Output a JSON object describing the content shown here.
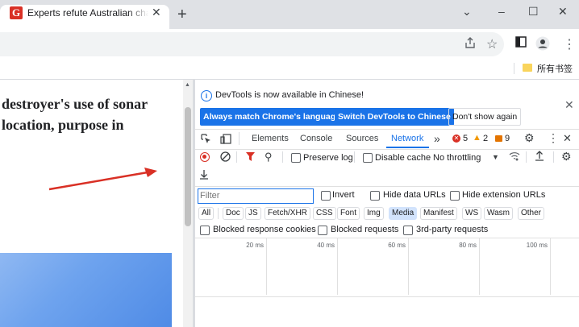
{
  "browser": {
    "tab": {
      "title": "Experts refute Australian cha",
      "favicon_letter": "G"
    },
    "new_tab_symbol": "+",
    "window_controls": {
      "dropdown": "⌄",
      "minimize": "–",
      "maximize": "☐",
      "close": "✕"
    },
    "bookmarks_bar": {
      "folder_label": "所有书签"
    }
  },
  "page": {
    "headline_line1": "destroyer's use of sonar",
    "headline_line2": "location, purpose in"
  },
  "devtools": {
    "infobar": {
      "message": "DevTools is now available in Chinese!",
      "btn_match": "Always match Chrome's language",
      "btn_switch": "Switch DevTools to Chinese",
      "btn_dont_show": "Don't show again"
    },
    "tabs": [
      "Elements",
      "Console",
      "Sources",
      "Network"
    ],
    "more_tabs": "»",
    "active_tab": "Network",
    "counts": {
      "errors": "5",
      "warnings": "2",
      "info": "9"
    },
    "network": {
      "preserve_log": "Preserve log",
      "disable_cache": "Disable cache",
      "throttling": "No throttling",
      "filter_placeholder": "Filter",
      "invert": "Invert",
      "hide_data_urls": "Hide data URLs",
      "hide_extension_urls": "Hide extension URLs",
      "type_filters": [
        "All",
        "Doc",
        "JS",
        "Fetch/XHR",
        "CSS",
        "Font",
        "Img",
        "Media",
        "Manifest",
        "WS",
        "Wasm",
        "Other"
      ],
      "active_type_filter": "Media",
      "blocked_response_cookies": "Blocked response cookies",
      "blocked_requests": "Blocked requests",
      "third_party_requests": "3rd-party requests",
      "timeline_ticks": [
        "20 ms",
        "40 ms",
        "60 ms",
        "80 ms",
        "100 ms"
      ]
    }
  },
  "colors": {
    "accent": "#1a73e8",
    "error": "#d93025",
    "warning": "#f29900",
    "info": "#e37400",
    "arrow": "#d93025"
  }
}
